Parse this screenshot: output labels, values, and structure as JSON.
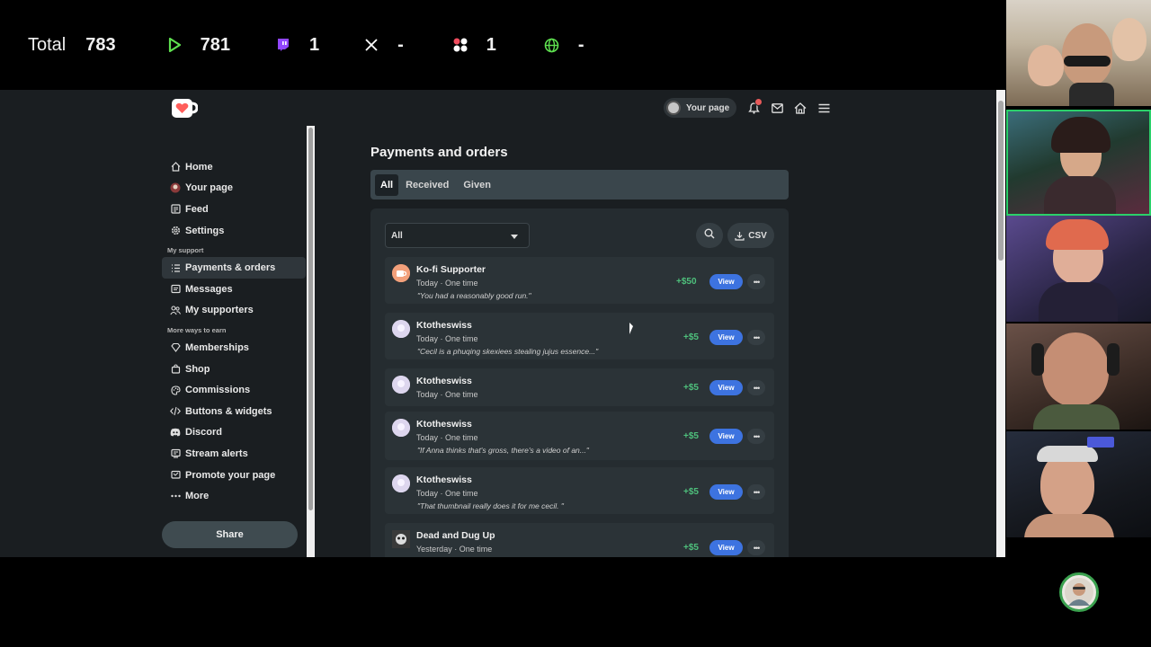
{
  "stats": {
    "total_label": "Total",
    "total_value": "783",
    "play_value": "781",
    "twitch_value": "1",
    "x_value": "-",
    "dots_value": "1",
    "web_value": "-"
  },
  "topnav": {
    "your_page": "Your page"
  },
  "sidebar": {
    "items_top": [
      {
        "label": "Home",
        "icon": "home-icon"
      },
      {
        "label": "Your page",
        "icon": "avatar-icon"
      },
      {
        "label": "Feed",
        "icon": "feed-icon"
      },
      {
        "label": "Settings",
        "icon": "gear-icon"
      }
    ],
    "section_support": "My support",
    "items_support": [
      {
        "label": "Payments & orders",
        "icon": "list-icon"
      },
      {
        "label": "Messages",
        "icon": "message-icon"
      },
      {
        "label": "My supporters",
        "icon": "people-icon"
      }
    ],
    "section_earn": "More ways to earn",
    "items_earn": [
      {
        "label": "Memberships",
        "icon": "diamond-icon"
      },
      {
        "label": "Shop",
        "icon": "bag-icon"
      },
      {
        "label": "Commissions",
        "icon": "palette-icon"
      },
      {
        "label": "Buttons & widgets",
        "icon": "code-icon"
      },
      {
        "label": "Discord",
        "icon": "discord-icon"
      },
      {
        "label": "Stream alerts",
        "icon": "alert-icon"
      },
      {
        "label": "Promote your page",
        "icon": "megaphone-icon"
      },
      {
        "label": "More",
        "icon": "more-icon"
      }
    ],
    "share_label": "Share"
  },
  "main": {
    "title": "Payments and orders",
    "tabs": [
      "All",
      "Received",
      "Given"
    ],
    "filter_value": "All",
    "csv_label": "CSV",
    "rows": [
      {
        "name": "Ko-fi Supporter",
        "meta": "Today · One time",
        "msg": "\"You had a reasonably good run.\"",
        "amount": "+$50",
        "view": "View",
        "avatar_color": "#f2a07b"
      },
      {
        "name": "Ktotheswiss",
        "meta": "Today · One time",
        "msg": "\"Cecil is a phuqing skexiees stealing jujus essence...\"",
        "amount": "+$5",
        "view": "View",
        "avatar_color": "#d9d4ea"
      },
      {
        "name": "Ktotheswiss",
        "meta": "Today · One time",
        "msg": "",
        "amount": "+$5",
        "view": "View",
        "avatar_color": "#d9d4ea"
      },
      {
        "name": "Ktotheswiss",
        "meta": "Today · One time",
        "msg": "\"If Anna thinks that's gross, there's a video of an...\"",
        "amount": "+$5",
        "view": "View",
        "avatar_color": "#d9d4ea"
      },
      {
        "name": "Ktotheswiss",
        "meta": "Today · One time",
        "msg": "\"That thumbnail really does it for me cecil. \"",
        "amount": "+$5",
        "view": "View",
        "avatar_color": "#d9d4ea"
      },
      {
        "name": "Dead and Dug Up",
        "meta": "Yesterday · One time",
        "msg": "",
        "amount": "+$5",
        "view": "View",
        "avatar_color": "#c8c8c8"
      }
    ]
  },
  "colors": {
    "accent_green": "#4ec07c",
    "view_blue": "#3d73e0",
    "panel_bg": "#1a1e21"
  }
}
